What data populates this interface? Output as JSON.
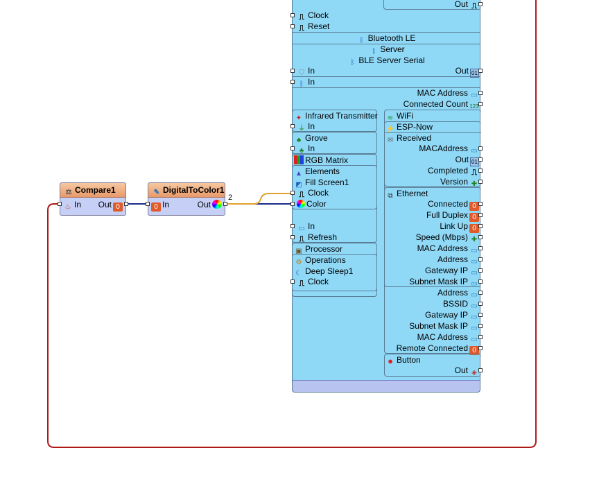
{
  "colors": {
    "board_fill": "#8fd8f6",
    "component_fill": "#c6d0f7",
    "component_title": "#e89a6a",
    "wire_blue": "#1a2a8a",
    "wire_orange": "#e0a030",
    "wire_red": "#b01818"
  },
  "components": {
    "compare": {
      "title": "Compare1",
      "in_label": "In",
      "out_label": "Out"
    },
    "digital_to_color": {
      "title": "DigitalToColor1",
      "in_label": "In",
      "out_label": "Out",
      "wire_index": "2"
    }
  },
  "board": {
    "top": {
      "out_label": "Out",
      "clock_label": "Clock",
      "reset_label": "Reset",
      "bluetooth_le": "Bluetooth LE",
      "server": "Server",
      "ble_server_serial": "BLE Server Serial",
      "in_label_1": "In",
      "out_label_2": "Out",
      "in_label_2": "In",
      "mac_address": "MAC Address",
      "connected_count": "Connected Count"
    },
    "left": {
      "infrared_transmitter": "Infrared Transmitter",
      "ir_in": "In",
      "grove": "Grove",
      "grove_in": "In",
      "rgb_matrix": "RGB Matrix",
      "elements": "Elements",
      "fill_screen": "Fill Screen1",
      "clock": "Clock",
      "color": "Color",
      "matrix_in": "In",
      "refresh": "Refresh",
      "processor": "Processor",
      "operations": "Operations",
      "deep_sleep": "Deep Sleep1",
      "sleep_clock": "Clock"
    },
    "right": {
      "wifi": "WiFi",
      "esp_now": "ESP-Now",
      "received": "Received",
      "mac_address": "MACAddress",
      "out": "Out",
      "completed": "Completed",
      "version": "Version",
      "ethernet": "Ethernet",
      "connected": "Connected",
      "full_duplex": "Full Duplex",
      "link_up": "Link Up",
      "speed": "Speed (Mbps)",
      "eth_mac_address": "MAC Address",
      "address": "Address",
      "gateway_ip": "Gateway IP",
      "subnet_mask_ip": "Subnet Mask IP",
      "wifi_address": "Address",
      "bssid": "BSSID",
      "wifi_gateway_ip": "Gateway IP",
      "wifi_subnet_mask_ip": "Subnet Mask IP",
      "wifi_mac_address": "MAC Address",
      "remote_connected": "Remote Connected",
      "button": "Button",
      "button_out": "Out"
    }
  }
}
